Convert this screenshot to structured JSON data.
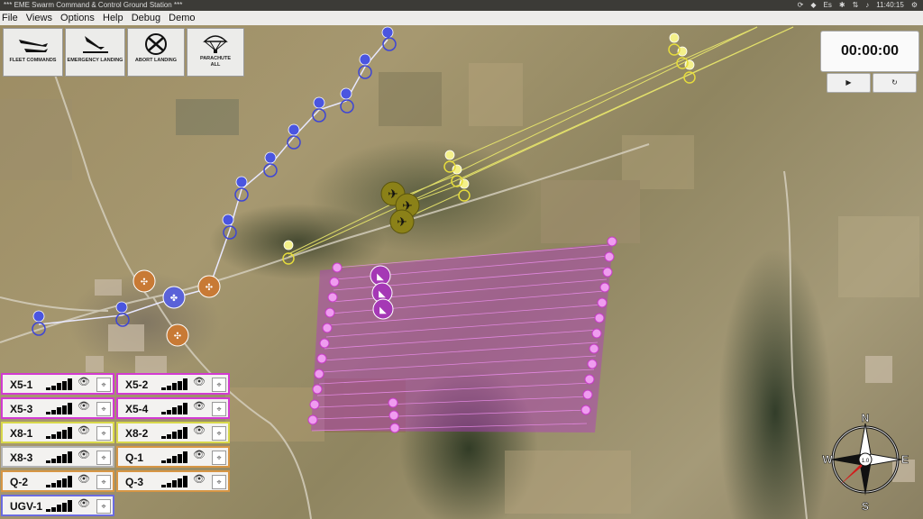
{
  "system_bar": {
    "title": "*** EME Swarm Command & Control Ground Station ***",
    "keyboard": "Es",
    "time": "11:40:15"
  },
  "menu": [
    "File",
    "Views",
    "Options",
    "Help",
    "Debug",
    "Demo"
  ],
  "fleet_commands": [
    {
      "label": "FLEET COMMANDS",
      "icon": "fleet-commands-icon"
    },
    {
      "label": "EMERGENCY LANDING",
      "icon": "emergency-landing-icon"
    },
    {
      "label": "ABORT LANDING",
      "icon": "abort-landing-icon"
    },
    {
      "label": "PARACHUTE ALL",
      "icon": "parachute-icon"
    }
  ],
  "timer": {
    "value": "00:00:00",
    "play": "▶",
    "reset": "↻"
  },
  "vehicles": [
    {
      "name": "X5-1",
      "color": "#d23bd2"
    },
    {
      "name": "X5-2",
      "color": "#d23bd2"
    },
    {
      "name": "X5-3",
      "color": "#d23bd2"
    },
    {
      "name": "X5-4",
      "color": "#d23bd2"
    },
    {
      "name": "X8-1",
      "color": "#d8d84a"
    },
    {
      "name": "X8-2",
      "color": "#d8d84a"
    },
    {
      "name": "X8-3",
      "color": "#b3b3b3"
    },
    {
      "name": "Q-1",
      "color": "#d79645"
    },
    {
      "name": "Q-2",
      "color": "#d79645"
    },
    {
      "name": "Q-3",
      "color": "#d79645"
    },
    {
      "name": "UGV-1",
      "color": "#6b6be0"
    }
  ],
  "compass": {
    "north": "N",
    "south": "S",
    "east": "E",
    "west": "W",
    "scale": "1.0"
  },
  "map_colors": {
    "blue": "#3d45d6",
    "yellow": "#f0ec6a",
    "magenta": "#d24fd6",
    "olive": "#8b8118",
    "orange": "#c87a35"
  }
}
